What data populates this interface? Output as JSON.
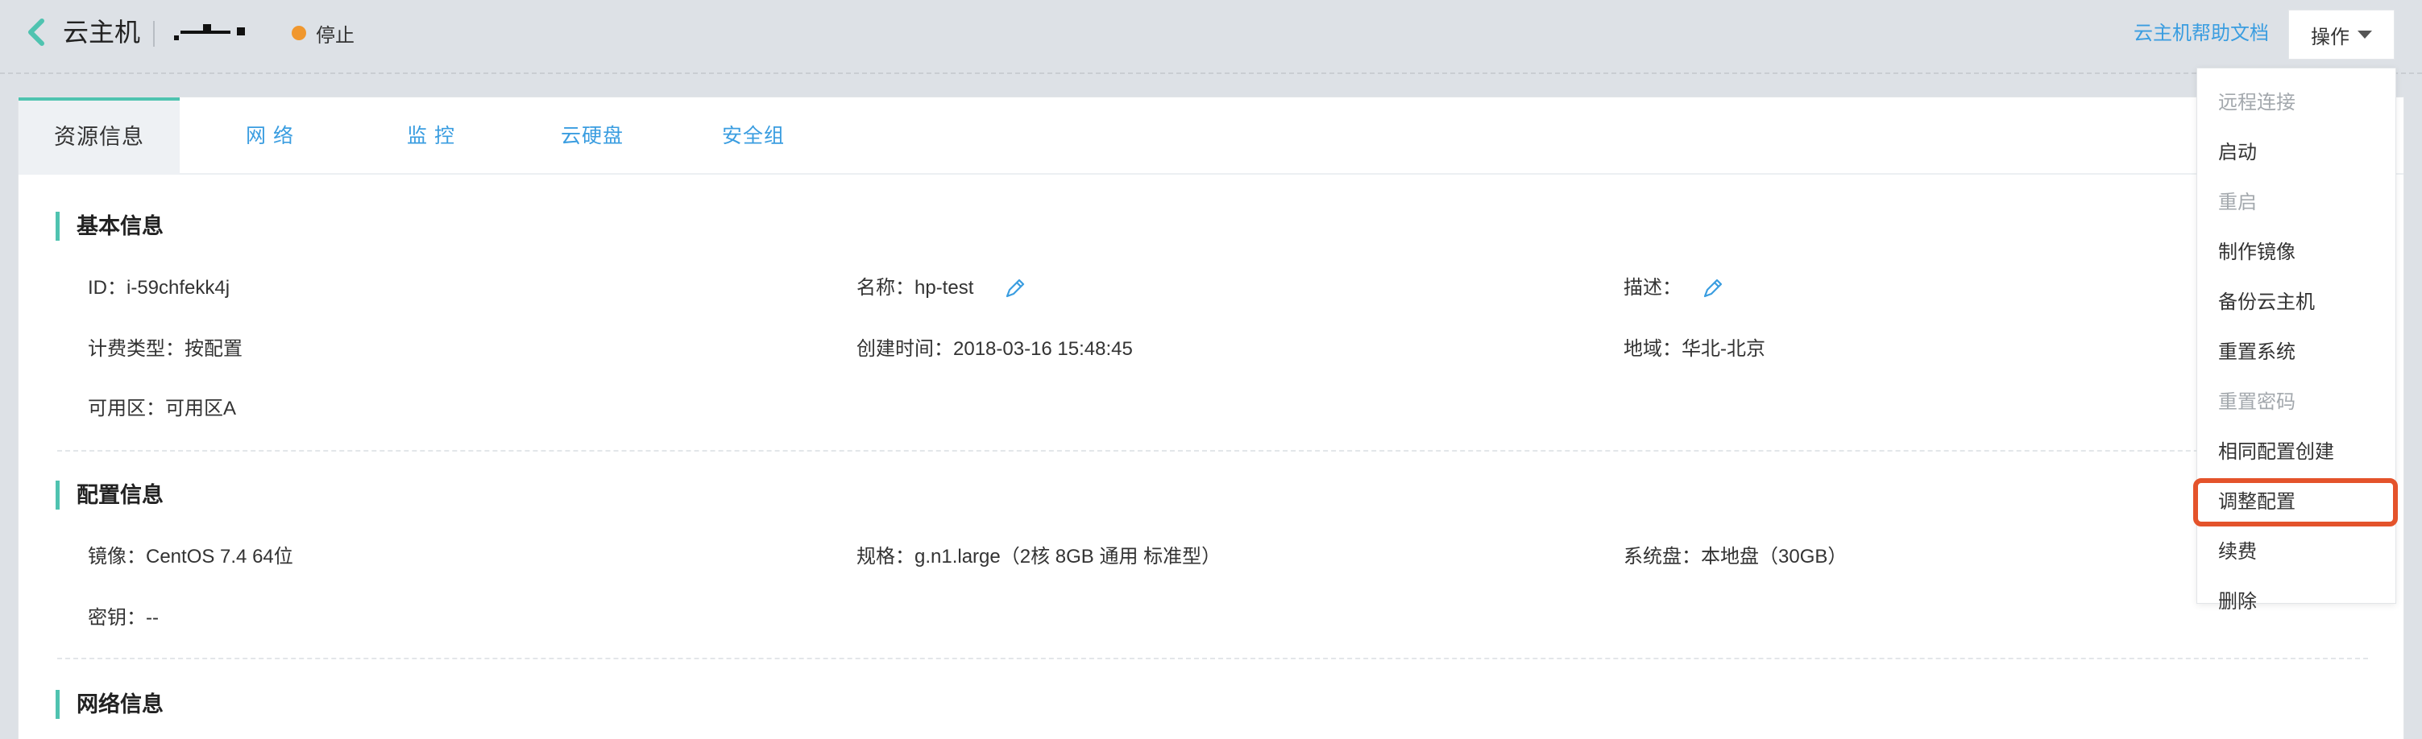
{
  "header": {
    "title": "云主机",
    "status": "停止",
    "help_link": "云主机帮助文档",
    "ops_label": "操作"
  },
  "tabs": [
    "资源信息",
    "网 络",
    "监 控",
    "云硬盘",
    "安全组"
  ],
  "basic": {
    "title": "基本信息",
    "id": "ID：i-59chfekk4j",
    "name": "名称：hp-test",
    "desc": "描述：",
    "billing": "计费类型：按配置",
    "created": "创建时间：2018-03-16 15:48:45",
    "region": "地域：华北-北京",
    "zone": "可用区：可用区A"
  },
  "config": {
    "title": "配置信息",
    "image": "镜像：CentOS 7.4 64位",
    "spec": "规格：g.n1.large（2核 8GB 通用 标准型）",
    "disk": "系统盘：本地盘（30GB）",
    "key": "密钥：--"
  },
  "network": {
    "title": "网络信息"
  },
  "menu": {
    "items": [
      {
        "label": "远程连接",
        "disabled": true
      },
      {
        "label": "启动",
        "disabled": false
      },
      {
        "label": "重启",
        "disabled": true
      },
      {
        "label": "制作镜像",
        "disabled": false
      },
      {
        "label": "备份云主机",
        "disabled": false
      },
      {
        "label": "重置系统",
        "disabled": false
      },
      {
        "label": "重置密码",
        "disabled": true
      },
      {
        "label": "相同配置创建",
        "disabled": false
      },
      {
        "label": "调整配置",
        "disabled": false
      },
      {
        "label": "续费",
        "disabled": false
      },
      {
        "label": "删除",
        "disabled": false
      }
    ]
  },
  "colors": {
    "accent": "#4fc3b0",
    "link": "#3a9de0",
    "status_stopped": "#f0972e",
    "highlight": "#e4532b"
  }
}
